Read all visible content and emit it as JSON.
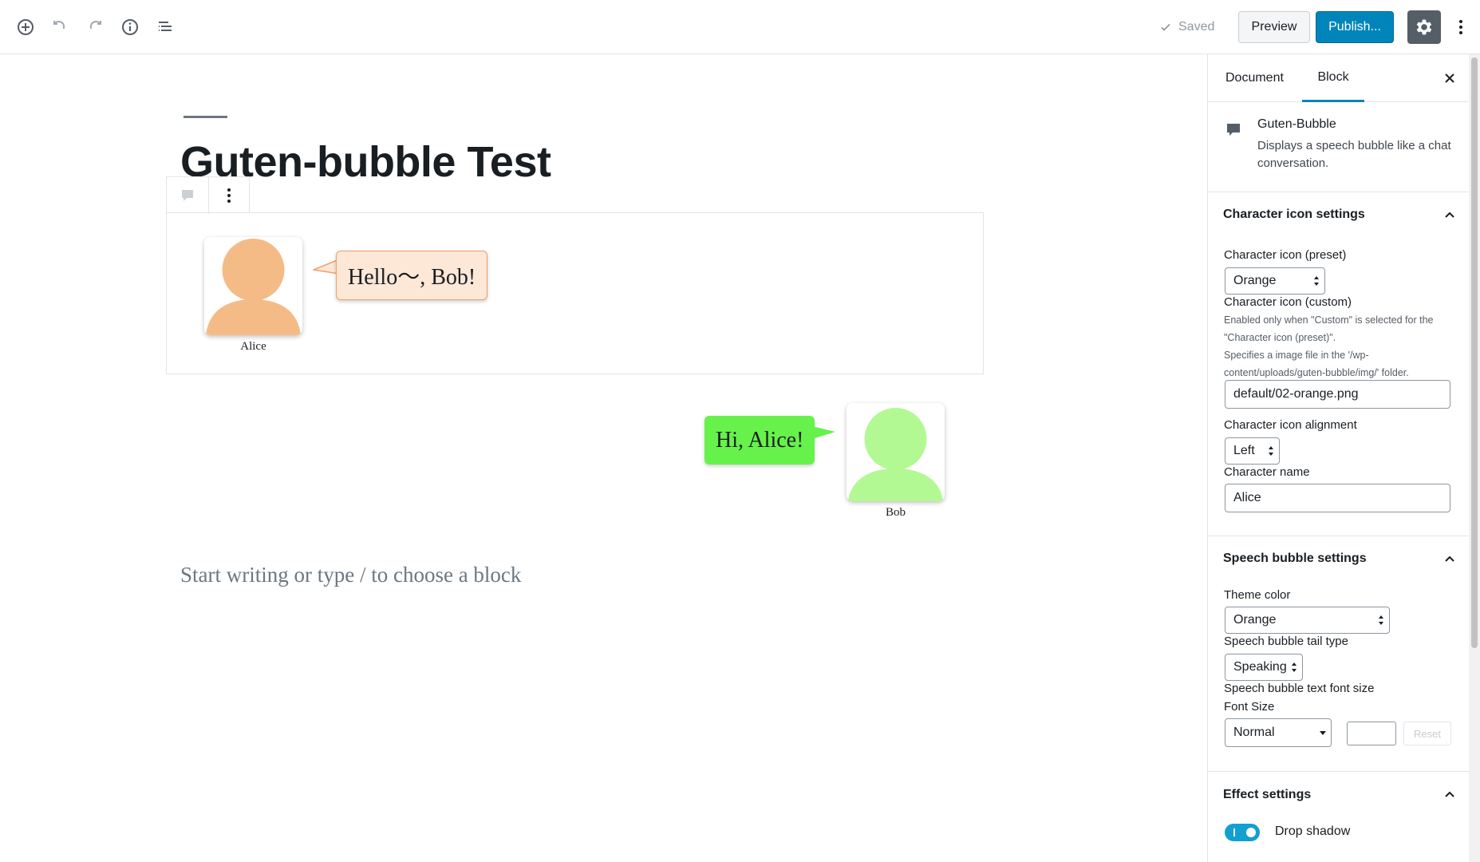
{
  "toolbar": {
    "saved_label": "Saved",
    "preview_label": "Preview",
    "publish_label": "Publish..."
  },
  "post": {
    "title": "Guten-bubble Test",
    "placeholder": "Start writing or type / to choose a block"
  },
  "bubbles": [
    {
      "character": "Alice",
      "text": "Hello～, Bob!",
      "color": "#f5bb87",
      "bubble_color": "#fde7d6"
    },
    {
      "character": "Bob",
      "text": "Hi, Alice!",
      "color": "#b3f993",
      "bubble_color": "#66f24a"
    }
  ],
  "sidebar": {
    "tabs": [
      "Document",
      "Block"
    ],
    "active_tab": "Block",
    "block": {
      "name": "Guten-Bubble",
      "description": "Displays a speech bubble like a chat conversation."
    },
    "character_panel": {
      "title": "Character icon settings",
      "preset_label": "Character icon (preset)",
      "preset_value": "Orange",
      "custom_label": "Character icon (custom)",
      "custom_help_1": "Enabled only when \"Custom\" is selected for the \"Character icon (preset)\".",
      "custom_help_2": "Specifies a image file in the '/wp-content/uploads/guten-bubble/img/' folder.",
      "custom_value": "default/02-orange.png",
      "alignment_label": "Character icon alignment",
      "alignment_value": "Left",
      "name_label": "Character name",
      "name_value": "Alice"
    },
    "bubble_panel": {
      "title": "Speech bubble settings",
      "theme_label": "Theme color",
      "theme_value": "Orange",
      "tail_label": "Speech bubble tail type",
      "tail_value": "Speaking",
      "font_label": "Speech bubble text font size",
      "font_size_label": "Font Size",
      "font_size_value": "Normal",
      "reset_label": "Reset"
    },
    "effect_panel": {
      "title": "Effect settings",
      "drop_shadow_label": "Drop shadow",
      "drop_shadow_on": true
    }
  },
  "colors": {
    "accent": "#0085ba",
    "toggle": "#11a0d2"
  }
}
